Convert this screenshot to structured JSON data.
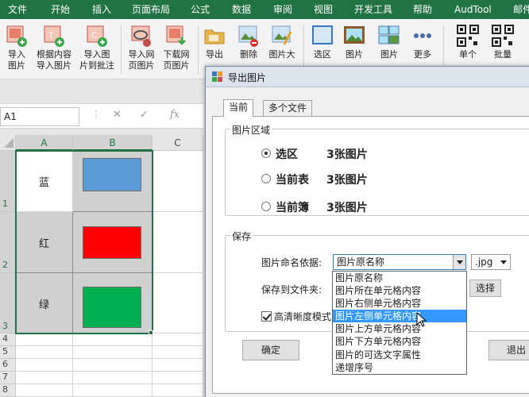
{
  "ribbon": {
    "tabs": [
      "文件",
      "开始",
      "插入",
      "页面布局",
      "公式",
      "数据",
      "审阅",
      "视图",
      "开发工具",
      "帮助",
      "AudTool",
      "邮件"
    ],
    "buttons": [
      {
        "label1": "导入",
        "label2": "图片",
        "icon": "import-image-icon"
      },
      {
        "label1": "根据内容",
        "label2": "导入图片",
        "icon": "import-by-content-icon"
      },
      {
        "label1": "导入图",
        "label2": "片到批注",
        "icon": "import-to-comment-icon"
      },
      {
        "label1": "导入网",
        "label2": "页图片",
        "icon": "import-web-image-icon"
      },
      {
        "label1": "下载网",
        "label2": "页图片",
        "icon": "download-web-image-icon"
      },
      {
        "label1": "导出",
        "label2": "",
        "icon": "export-folder-icon"
      },
      {
        "label1": "删除",
        "label2": "",
        "icon": "delete-image-icon"
      },
      {
        "label1": "图片大",
        "label2": "",
        "icon": "image-resize-icon"
      },
      {
        "label1": "选区",
        "label2": "",
        "icon": "selection-icon"
      },
      {
        "label1": "图片",
        "label2": "",
        "icon": "picture-frame-icon"
      },
      {
        "label1": "图片",
        "label2": "",
        "icon": "picture-stack-icon"
      },
      {
        "label1": "更多",
        "label2": "",
        "icon": "more-dots-icon"
      },
      {
        "label1": "单个",
        "label2": "",
        "icon": "qr-single-icon"
      },
      {
        "label1": "批量",
        "label2": "",
        "icon": "qr-batch-icon"
      }
    ]
  },
  "formula_bar": {
    "name_box": "A1",
    "fx": "fx"
  },
  "grid": {
    "columns": [
      "A",
      "B",
      "C"
    ],
    "rows": [
      "1",
      "2",
      "3",
      "4",
      "5",
      "6",
      "7",
      "8"
    ],
    "cells": [
      {
        "label": "蓝",
        "color": "#5b9bd5"
      },
      {
        "label": "红",
        "color": "#ff0000"
      },
      {
        "label": "绿",
        "color": "#00b050"
      }
    ]
  },
  "dialog": {
    "title": "导出图片",
    "tabs": [
      "当前",
      "多个文件"
    ],
    "image_area": {
      "title": "图片区域",
      "options": [
        {
          "label": "选区",
          "count": "3张图片",
          "checked": true
        },
        {
          "label": "当前表",
          "count": "3张图片",
          "checked": false
        },
        {
          "label": "当前簿",
          "count": "3张图片",
          "checked": false
        }
      ]
    },
    "save": {
      "title": "保存",
      "naming_label": "图片命名依据:",
      "naming_value": "图片原名称",
      "format_value": ".jpg",
      "folder_label": "保存到文件夹:",
      "browse_label": "选择",
      "hd_label": "高清晰度模式",
      "hd_checked": true
    },
    "dropdown_options": [
      "图片原名称",
      "图片所在单元格内容",
      "图片右侧单元格内容",
      "图片左侧单元格内容",
      "图片上方单元格内容",
      "图片下方单元格内容",
      "图片的可选文字属性",
      "递增序号"
    ],
    "dropdown_hover_index": 3,
    "ok_label": "确定",
    "exit_label": "退出"
  }
}
